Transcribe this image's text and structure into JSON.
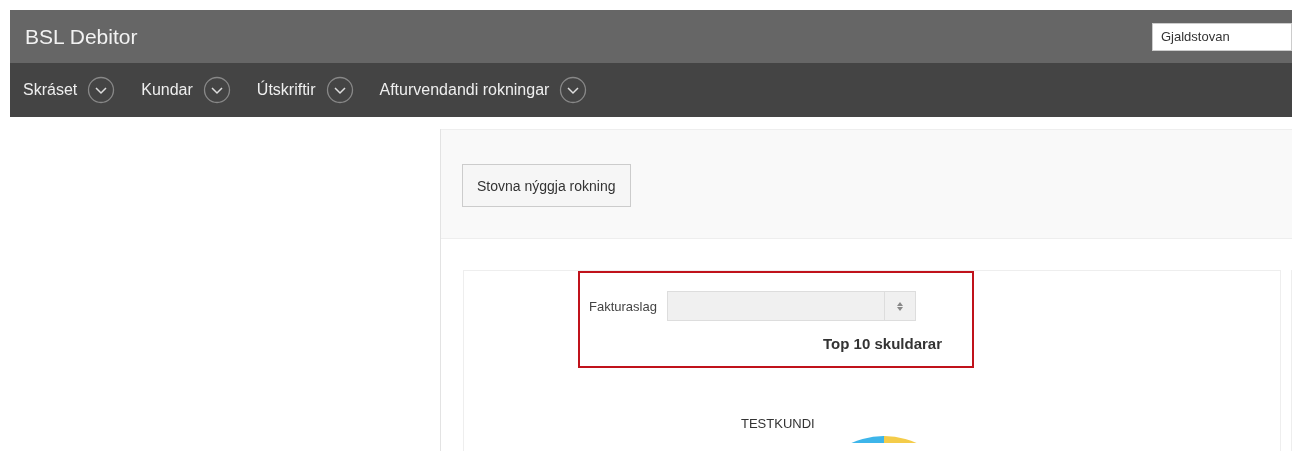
{
  "app_title": "BSL Debitor",
  "company_select": {
    "value": "Gjaldstovan"
  },
  "menu": [
    {
      "label": "Skráset"
    },
    {
      "label": "Kundar"
    },
    {
      "label": "Útskriftir"
    },
    {
      "label": "Afturvendandi rokningar"
    }
  ],
  "new_invoice_button": "Stovna nýggja rokning",
  "filter": {
    "label": "Fakturaslag"
  },
  "chart_title": "Top 10 skuldarar",
  "pie_label": "TESTKUNDI"
}
